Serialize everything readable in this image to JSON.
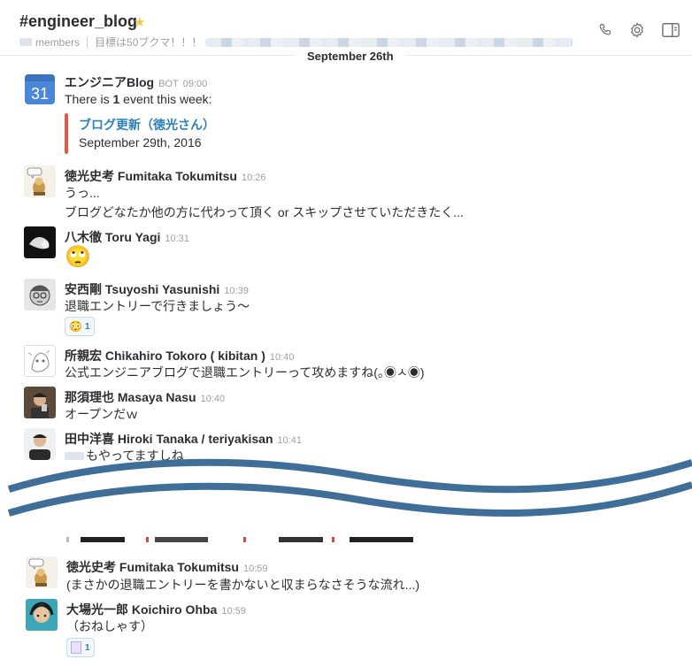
{
  "header": {
    "channel_name": "#engineer_blog",
    "members_label": "members",
    "purpose": "目標は50ブクマ！！！"
  },
  "day_divider": "September 26th",
  "messages": [
    {
      "name": "エンジニアBlog",
      "bot_tag": "BOT",
      "time": "09:00",
      "text_prefix": "There is ",
      "text_count": "1",
      "text_suffix": " event this week:",
      "event_title": "ブログ更新（徳光さん）",
      "event_date": "September 29th, 2016",
      "calendar_day": "31"
    },
    {
      "name": "徳光史考 Fumitaka Tokumitsu",
      "time": "10:26",
      "line1": "うっ...",
      "line2": "ブログどなたか他の方に代わって頂く or スキップさせていただきたく..."
    },
    {
      "name": "八木徹 Toru Yagi",
      "time": "10:31",
      "emoji": "🙄"
    },
    {
      "name": "安西剛 Tsuyoshi Yasunishi",
      "time": "10:39",
      "text": "退職エントリーで行きましょう〜",
      "reaction_emoji": "😳",
      "reaction_count": "1"
    },
    {
      "name": "所親宏 Chikahiro Tokoro ( kibitan )",
      "time": "10:40",
      "text": "公式エンジニアブログで退職エントリーって攻めますね(｡◉ㅅ◉)"
    },
    {
      "name": "那須理也 Masaya Nasu",
      "time": "10:40",
      "text": "オープンだｗ"
    },
    {
      "name": "田中洋喜 Hiroki Tanaka / teriyakisan",
      "time": "10:41",
      "text": "もやってますしね"
    },
    {
      "name": "徳光史考 Fumitaka Tokumitsu",
      "time": "10:59",
      "text": "(まさかの退職エントリーを書かないと収まらなさそうな流れ...)"
    },
    {
      "name": "大場光一郎 Koichiro Ohba",
      "time": "10:59",
      "text": "（おねしゃす）",
      "reaction_count": "1"
    }
  ],
  "colors": {
    "accent_link": "#2a80b9",
    "event_bar": "#e0584a",
    "wave": "#3f6f98",
    "star": "#f2c744"
  },
  "icons": [
    "star-icon",
    "phone-icon",
    "gear-icon",
    "sidebar-toggle-icon",
    "calendar-icon"
  ]
}
